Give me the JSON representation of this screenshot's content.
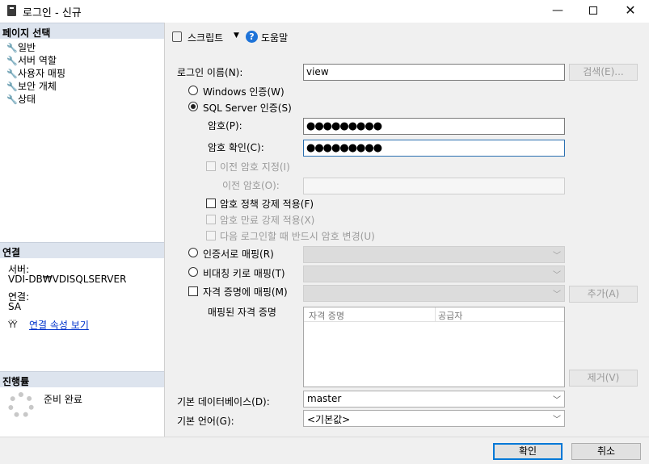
{
  "window": {
    "title": "로그인 - 신규",
    "minimize": "—",
    "close": "✕"
  },
  "left": {
    "page_select_header": "페이지 선택",
    "pages": [
      {
        "label": "일반"
      },
      {
        "label": "서버 역할"
      },
      {
        "label": "사용자 매핑"
      },
      {
        "label": "보안 개체"
      },
      {
        "label": "상태"
      }
    ],
    "connection_header": "연결",
    "server_label": "서버:",
    "server_value": "VDI-DB₩VDISQLSERVER",
    "connection_label": "연결:",
    "connection_value": "SA",
    "connection_props_link": "연결 속성 보기",
    "progress_header": "진행률",
    "progress_status": "준비 완료"
  },
  "toolbar": {
    "script_label": "스크립트",
    "help_label": "도움말"
  },
  "form": {
    "login_name_label": "로그인 이름(N):",
    "login_name_value": "view",
    "search_button": "검색(E)...",
    "windows_auth_label": "Windows 인증(W)",
    "sql_auth_label": "SQL Server 인증(S)",
    "password_label": "암호(P):",
    "password_value": "●●●●●●●●●",
    "confirm_password_label": "암호 확인(C):",
    "confirm_password_value": "●●●●●●●●●",
    "specify_old_password_label": "이전 암호 지정(I)",
    "old_password_label": "이전 암호(O):",
    "enforce_policy_label": "암호 정책 강제 적용(F)",
    "enforce_expiration_label": "암호 만료 강제 적용(X)",
    "must_change_label": "다음 로그인할 때 반드시 암호 변경(U)",
    "cert_mapped_label": "인증서로 매핑(R)",
    "asym_key_mapped_label": "비대칭 키로 매핑(T)",
    "credential_mapped_label": "자격 증명에 매핑(M)",
    "add_button": "추가(A)",
    "mapped_credentials_label": "매핑된 자격 증명",
    "grid_columns": [
      "자격 증명",
      "공급자"
    ],
    "remove_button": "제거(V)",
    "default_database_label": "기본 데이터베이스(D):",
    "default_database_value": "master",
    "default_language_label": "기본 언어(G):",
    "default_language_value": "<기본값>"
  },
  "footer": {
    "ok_button": "확인",
    "cancel_button": "취소"
  }
}
